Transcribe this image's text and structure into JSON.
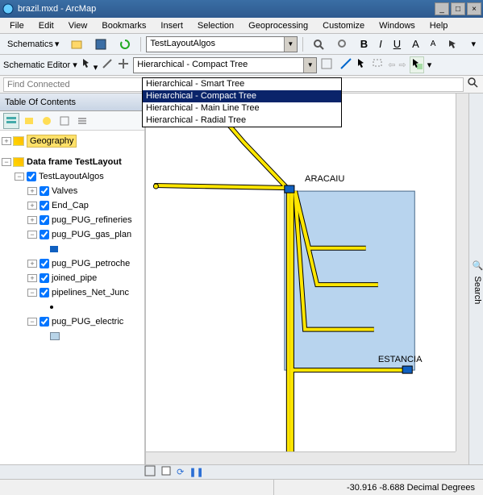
{
  "window": {
    "title": "brazil.mxd - ArcMap"
  },
  "menu": {
    "items": [
      "File",
      "Edit",
      "View",
      "Bookmarks",
      "Insert",
      "Selection",
      "Geoprocessing",
      "Customize",
      "Windows",
      "Help"
    ]
  },
  "toolbar1": {
    "schematics_label": "Schematics",
    "combo_value": "TestLayoutAlgos",
    "bold": "B",
    "italic": "I",
    "underline": "U",
    "font_a1": "A",
    "font_a2": "A"
  },
  "toolbar2": {
    "editor_label": "Schematic Editor",
    "layout_combo": "Hierarchical - Compact Tree"
  },
  "dropdown": {
    "options": [
      "Hierarchical - Smart Tree",
      "Hierarchical - Compact Tree",
      "Hierarchical - Main Line Tree",
      "Hierarchical - Radial Tree"
    ],
    "selected": 1
  },
  "find": {
    "placeholder": "Find Connected"
  },
  "toc": {
    "title": "Table Of Contents",
    "root": "Geography",
    "dataframe": "Data frame TestLayout",
    "dataset": "TestLayoutAlgos",
    "layers": [
      "Valves",
      "End_Cap",
      "pug_PUG_refineries",
      "pug_PUG_gas_plan",
      "pug_PUG_petroche",
      "joined_pipe",
      "pipelines_Net_Junc",
      "pug_PUG_electric"
    ]
  },
  "map": {
    "label_top": "ARACAIU",
    "label_bottom": "ESTANCIA"
  },
  "right_panel": "Search",
  "status": {
    "coords": "-30.916 -8.688 Decimal Degrees"
  }
}
